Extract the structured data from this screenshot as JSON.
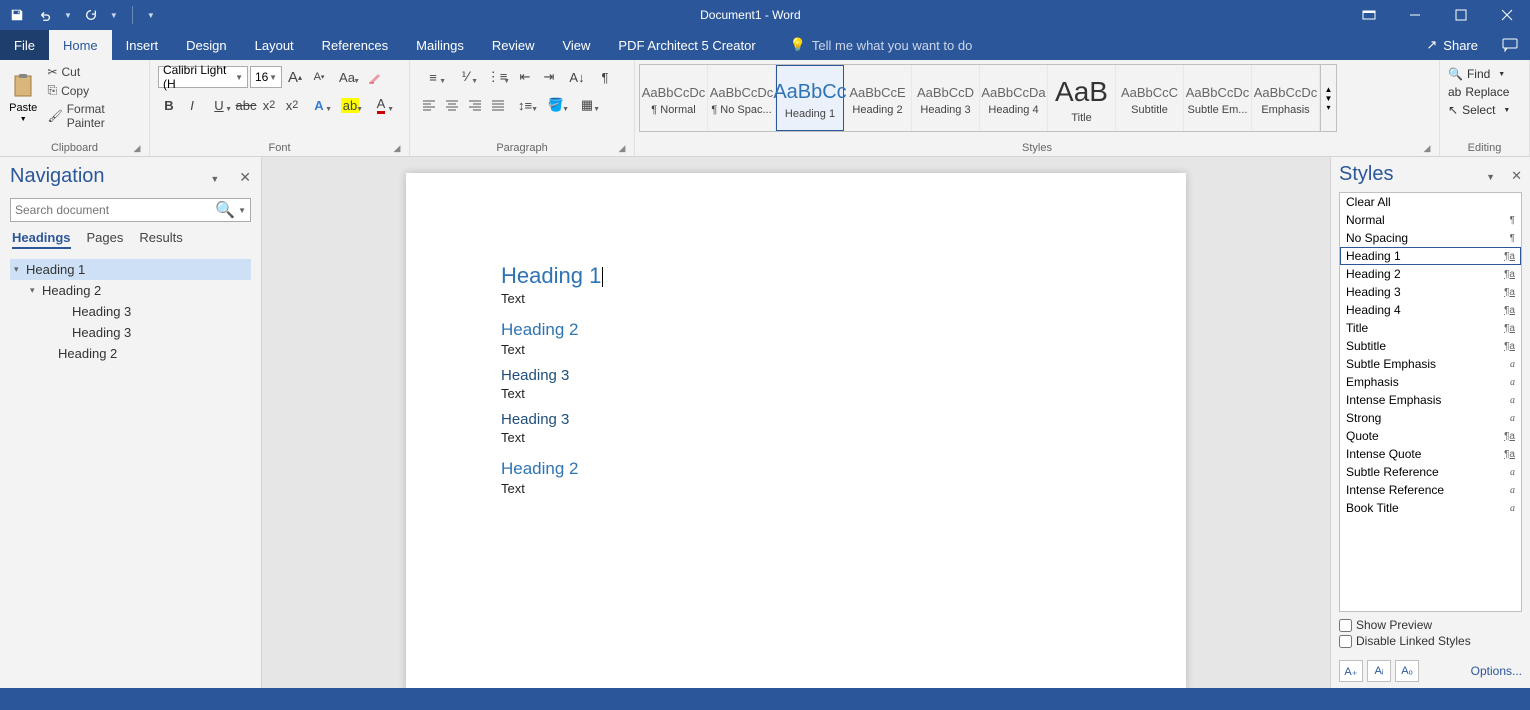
{
  "window": {
    "title": "Document1 - Word"
  },
  "tabs": {
    "file": "File",
    "home": "Home",
    "insert": "Insert",
    "design": "Design",
    "layout": "Layout",
    "references": "References",
    "mailings": "Mailings",
    "review": "Review",
    "view": "View",
    "pdf": "PDF Architect 5 Creator",
    "tellme": "Tell me what you want to do",
    "share": "Share"
  },
  "clipboard": {
    "paste": "Paste",
    "cut": "Cut",
    "copy": "Copy",
    "painter": "Format Painter",
    "label": "Clipboard"
  },
  "font": {
    "name": "Calibri Light (H",
    "size": "16",
    "label": "Font"
  },
  "paragraph": {
    "label": "Paragraph"
  },
  "styles_ribbon": {
    "label": "Styles",
    "items": [
      {
        "preview": "AaBbCcDc",
        "label": "¶ Normal",
        "cls": ""
      },
      {
        "preview": "AaBbCcDc",
        "label": "¶ No Spac...",
        "cls": ""
      },
      {
        "preview": "AaBbCc",
        "label": "Heading 1",
        "cls": "h1",
        "selected": true
      },
      {
        "preview": "AaBbCcE",
        "label": "Heading 2",
        "cls": ""
      },
      {
        "preview": "AaBbCcD",
        "label": "Heading 3",
        "cls": ""
      },
      {
        "preview": "AaBbCcDa",
        "label": "Heading 4",
        "cls": ""
      },
      {
        "preview": "AaB",
        "label": "Title",
        "cls": "big"
      },
      {
        "preview": "AaBbCcC",
        "label": "Subtitle",
        "cls": ""
      },
      {
        "preview": "AaBbCcDc",
        "label": "Subtle Em...",
        "cls": ""
      },
      {
        "preview": "AaBbCcDc",
        "label": "Emphasis",
        "cls": ""
      }
    ]
  },
  "editing": {
    "find": "Find",
    "replace": "Replace",
    "select": "Select",
    "label": "Editing"
  },
  "nav": {
    "title": "Navigation",
    "search_placeholder": "Search document",
    "tabs": {
      "headings": "Headings",
      "pages": "Pages",
      "results": "Results"
    },
    "tree": [
      {
        "label": "Heading 1",
        "indent": 0,
        "selected": true,
        "toggle": "▾"
      },
      {
        "label": "Heading 2",
        "indent": 1,
        "toggle": "▾"
      },
      {
        "label": "Heading 3",
        "indent": 2
      },
      {
        "label": "Heading 3",
        "indent": 2
      },
      {
        "label": "Heading 2",
        "indent": "0b"
      }
    ]
  },
  "document": {
    "blocks": [
      {
        "type": "h1",
        "text": "Heading 1",
        "cursor": true
      },
      {
        "type": "text",
        "text": "Text"
      },
      {
        "type": "h2",
        "text": "Heading 2"
      },
      {
        "type": "text",
        "text": "Text"
      },
      {
        "type": "h3",
        "text": "Heading 3"
      },
      {
        "type": "text",
        "text": "Text"
      },
      {
        "type": "h3",
        "text": "Heading 3"
      },
      {
        "type": "text",
        "text": "Text"
      },
      {
        "type": "h2",
        "text": "Heading 2"
      },
      {
        "type": "text",
        "text": "Text"
      }
    ]
  },
  "styles_pane": {
    "title": "Styles",
    "items": [
      {
        "name": "Clear All",
        "marker": ""
      },
      {
        "name": "Normal",
        "marker": "¶"
      },
      {
        "name": "No Spacing",
        "marker": "¶"
      },
      {
        "name": "Heading 1",
        "marker": "¶a",
        "selected": true
      },
      {
        "name": "Heading 2",
        "marker": "¶a"
      },
      {
        "name": "Heading 3",
        "marker": "¶a"
      },
      {
        "name": "Heading 4",
        "marker": "¶a"
      },
      {
        "name": "Title",
        "marker": "¶a"
      },
      {
        "name": "Subtitle",
        "marker": "¶a"
      },
      {
        "name": "Subtle Emphasis",
        "marker": "a"
      },
      {
        "name": "Emphasis",
        "marker": "a"
      },
      {
        "name": "Intense Emphasis",
        "marker": "a"
      },
      {
        "name": "Strong",
        "marker": "a"
      },
      {
        "name": "Quote",
        "marker": "¶a"
      },
      {
        "name": "Intense Quote",
        "marker": "¶a"
      },
      {
        "name": "Subtle Reference",
        "marker": "a"
      },
      {
        "name": "Intense Reference",
        "marker": "a"
      },
      {
        "name": "Book Title",
        "marker": "a"
      }
    ],
    "show_preview": "Show Preview",
    "disable_linked": "Disable Linked Styles",
    "options": "Options..."
  }
}
